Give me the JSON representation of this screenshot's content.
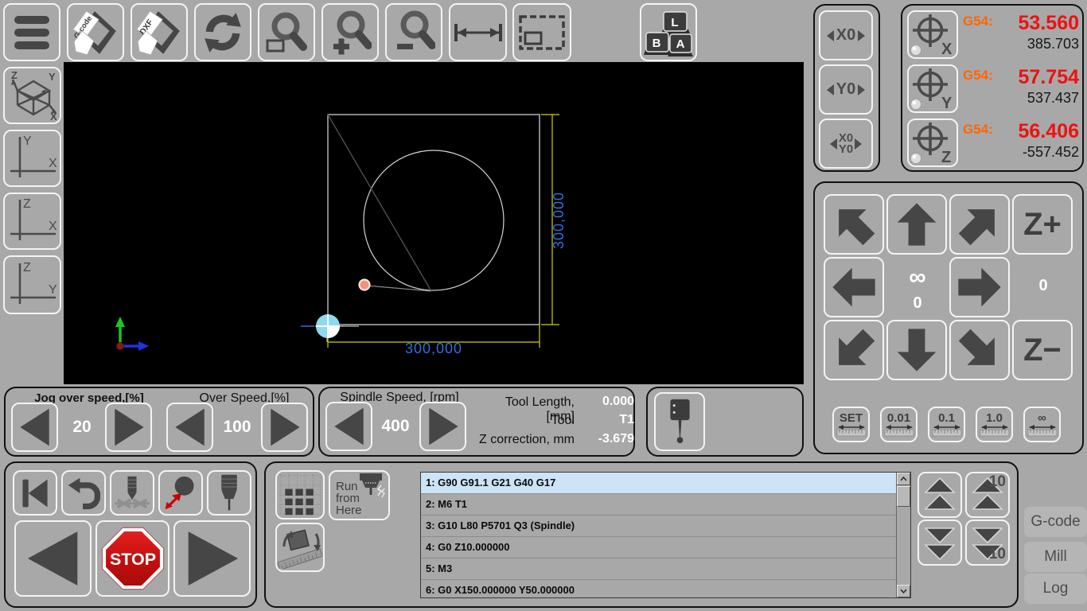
{
  "toolbar": {
    "gcode_folder_label": "G-code",
    "dxf_folder_label": "DXF",
    "keyboard_keys": [
      "L",
      "B",
      "A"
    ]
  },
  "views": {
    "cube": {
      "up": "Z",
      "right": "Y",
      "down": "X"
    },
    "xy": {
      "v": "Y",
      "h": "X"
    },
    "zx": {
      "v": "Z",
      "h": "X"
    },
    "zy": {
      "v": "Z",
      "h": "Y"
    }
  },
  "canvas": {
    "dim_bottom": "300,000",
    "dim_right": "300,000"
  },
  "zero": {
    "x": "X0",
    "y": "Y0",
    "xy1": "X0",
    "xy2": "Y0"
  },
  "coords": {
    "rows": [
      {
        "axis": "X",
        "wcs": "G54:",
        "work": "53.560",
        "machine": "385.703"
      },
      {
        "axis": "Y",
        "wcs": "G54:",
        "work": "57.754",
        "machine": "537.437"
      },
      {
        "axis": "Z",
        "wcs": "G54:",
        "work": "56.406",
        "machine": "-557.452"
      }
    ]
  },
  "jog": {
    "z_plus": "Z+",
    "z_minus": "Z−",
    "center_inf": "∞",
    "center_zero": "0",
    "z_step": "0",
    "steps": [
      "SET",
      "0.01",
      "0.1",
      "1.0",
      "∞"
    ]
  },
  "speeds": {
    "jog_label": "Jog over speed,[%]",
    "jog_value": "20",
    "over_label": "Over Speed,[%]",
    "over_value": "100",
    "spindle_label": "Spindle Speed, [rpm]",
    "spindle_value": "400"
  },
  "tool": {
    "length_label": "Tool Length, [mm]",
    "length_value": "0.000",
    "tool_label": "Tool",
    "tool_value": "T1",
    "z_corr_label": "Z correction, mm",
    "z_corr_value": "-3.679"
  },
  "transport": {
    "stop_label": "STOP"
  },
  "program": {
    "run_from_here": [
      "Run",
      "from",
      "Here"
    ],
    "scroll_step": "10",
    "lines": [
      "1: G90 G91.1 G21 G40 G17",
      "2: M6 T1",
      "3: G10 L80 P5701 Q3 (Spindle)",
      "4: G0 Z10.000000",
      "5: M3",
      "6: G0 X150.000000 Y50.000000"
    ],
    "selected_index": 0
  },
  "tabs": {
    "gcode": "G-code",
    "mill": "Mill",
    "log": "Log"
  }
}
